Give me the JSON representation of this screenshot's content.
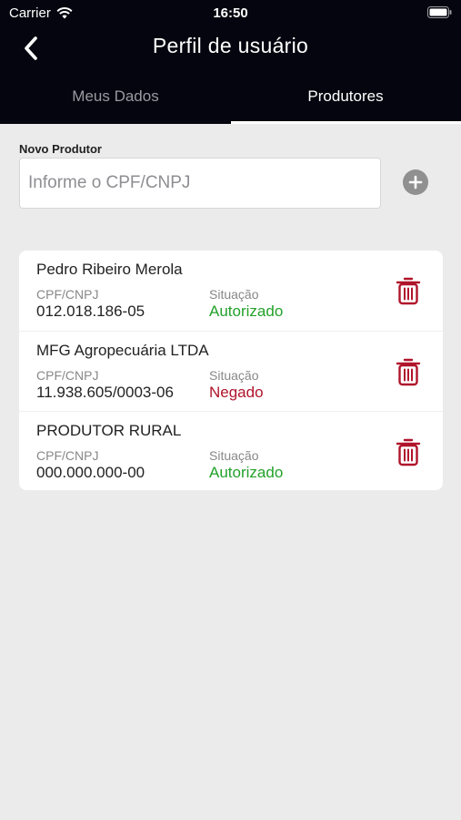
{
  "status_bar": {
    "carrier": "Carrier",
    "time": "16:50"
  },
  "nav": {
    "title": "Perfil de usuário",
    "back_icon": "chevron-left-icon"
  },
  "tabs": [
    {
      "label": "Meus Dados",
      "active": false
    },
    {
      "label": "Produtores",
      "active": true
    }
  ],
  "form": {
    "label": "Novo Produtor",
    "placeholder": "Informe o CPF/CNPJ",
    "value": "",
    "add_icon": "plus-circle-icon"
  },
  "producers": [
    {
      "name": "Pedro Ribeiro Merola",
      "doc_label": "CPF/CNPJ",
      "doc": "012.018.186-05",
      "status_label": "Situação",
      "status": "Autorizado",
      "status_color": "#22a12a"
    },
    {
      "name": "MFG Agropecuária LTDA",
      "doc_label": "CPF/CNPJ",
      "doc": "11.938.605/0003-06",
      "status_label": "Situação",
      "status": "Negado",
      "status_color": "#b0142a"
    },
    {
      "name": "PRODUTOR RURAL",
      "doc_label": "CPF/CNPJ",
      "doc": "000.000.000-00",
      "status_label": "Situação",
      "status": "Autorizado",
      "status_color": "#22a12a"
    }
  ],
  "colors": {
    "header_bg": "#05050f",
    "page_bg": "#ebebeb",
    "trash_icon": "#b0142a"
  }
}
